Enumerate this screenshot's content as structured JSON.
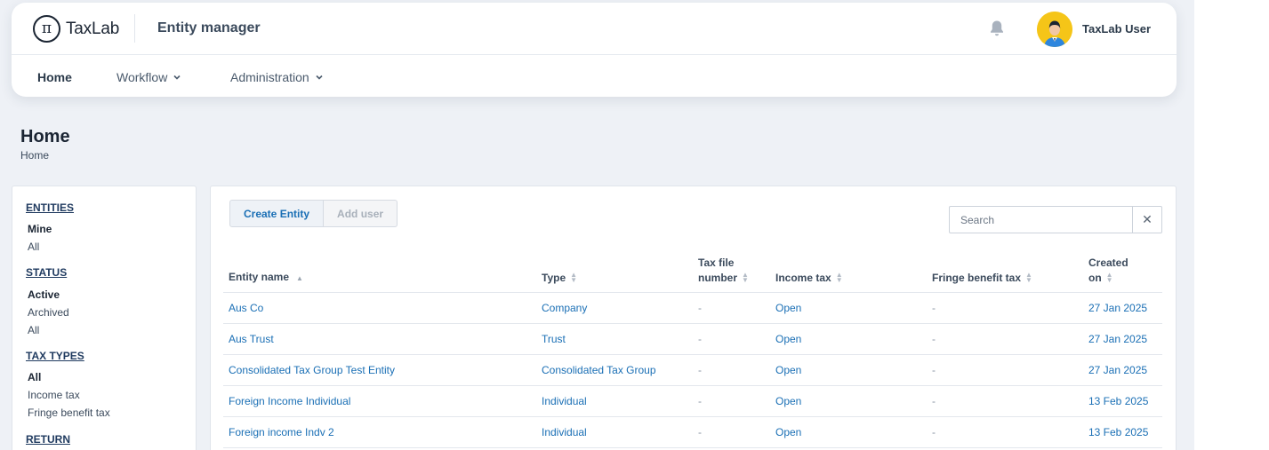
{
  "header": {
    "logo_text": "TaxLab",
    "logo_symbol": "π",
    "app_title": "Entity manager",
    "user_name": "TaxLab User"
  },
  "nav": {
    "items": [
      {
        "label": "Home",
        "active": true
      },
      {
        "label": "Workflow",
        "dropdown": true
      },
      {
        "label": "Administration",
        "dropdown": true
      }
    ]
  },
  "page": {
    "title": "Home",
    "breadcrumb": "Home"
  },
  "filters": {
    "entities": {
      "heading": "ENTITIES",
      "items": [
        "Mine",
        "All"
      ],
      "selected": "Mine"
    },
    "status": {
      "heading": "STATUS",
      "items": [
        "Active",
        "Archived",
        "All"
      ],
      "selected": "Active"
    },
    "tax_types": {
      "heading": "TAX TYPES",
      "items": [
        "All",
        "Income tax",
        "Fringe benefit tax"
      ],
      "selected": "All"
    },
    "return": {
      "heading": "RETURN"
    }
  },
  "toolbar": {
    "create_label": "Create Entity",
    "add_user_label": "Add user",
    "search_placeholder": "Search",
    "clear_symbol": "✕"
  },
  "table": {
    "headers": {
      "entity_name": "Entity name",
      "type": "Type",
      "tfn_line1": "Tax file",
      "tfn_line2": "number",
      "income_tax": "Income tax",
      "fbt": "Fringe benefit tax",
      "created_line1": "Created",
      "created_line2": "on"
    },
    "rows": [
      {
        "name": "Aus Co",
        "type": "Company",
        "tfn": "-",
        "income_tax": "Open",
        "fbt": "-",
        "created": "27 Jan 2025"
      },
      {
        "name": "Aus Trust",
        "type": "Trust",
        "tfn": "-",
        "income_tax": "Open",
        "fbt": "-",
        "created": "27 Jan 2025"
      },
      {
        "name": "Consolidated Tax Group Test Entity",
        "type": "Consolidated Tax Group",
        "tfn": "-",
        "income_tax": "Open",
        "fbt": "-",
        "created": "27 Jan 2025"
      },
      {
        "name": "Foreign Income Individual",
        "type": "Individual",
        "tfn": "-",
        "income_tax": "Open",
        "fbt": "-",
        "created": "13 Feb 2025"
      },
      {
        "name": "Foreign income Indv 2",
        "type": "Individual",
        "tfn": "-",
        "income_tax": "Open",
        "fbt": "-",
        "created": "13 Feb 2025"
      }
    ]
  },
  "colors": {
    "link": "#1a6fb5",
    "background": "#eef1f6",
    "avatar_bg": "#f5c518"
  }
}
